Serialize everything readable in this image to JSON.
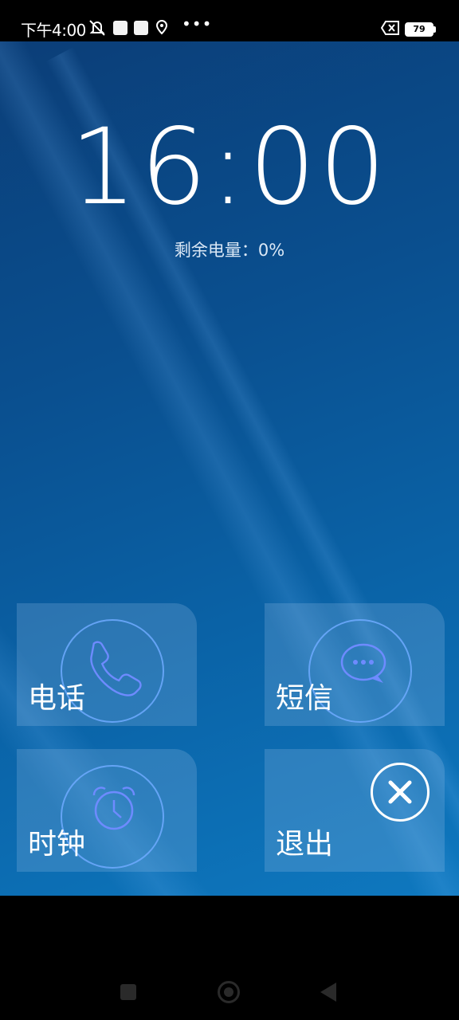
{
  "status_bar": {
    "time": "下午4:00",
    "battery_level": "79",
    "icons": [
      "mute-icon",
      "notification-square-icon",
      "notification-square-icon",
      "location-icon",
      "more-dots-icon",
      "sim-none-icon",
      "battery-icon"
    ]
  },
  "lock_screen": {
    "clock": "16:00",
    "battery_remaining": "剩余电量：0%"
  },
  "tiles": {
    "phone": {
      "label": "电话",
      "icon": "phone-icon"
    },
    "sms": {
      "label": "短信",
      "icon": "message-bubble-icon"
    },
    "clock": {
      "label": "时钟",
      "icon": "alarm-clock-icon"
    },
    "exit": {
      "label": "退出",
      "icon": "close-icon"
    }
  },
  "colors": {
    "accent_ring": "#6eaaff",
    "wallpaper_top": "#0b3e78",
    "wallpaper_bottom": "#0e78bf"
  },
  "nav_bar": {
    "buttons": [
      "recent-apps-button",
      "home-button",
      "back-button"
    ]
  }
}
